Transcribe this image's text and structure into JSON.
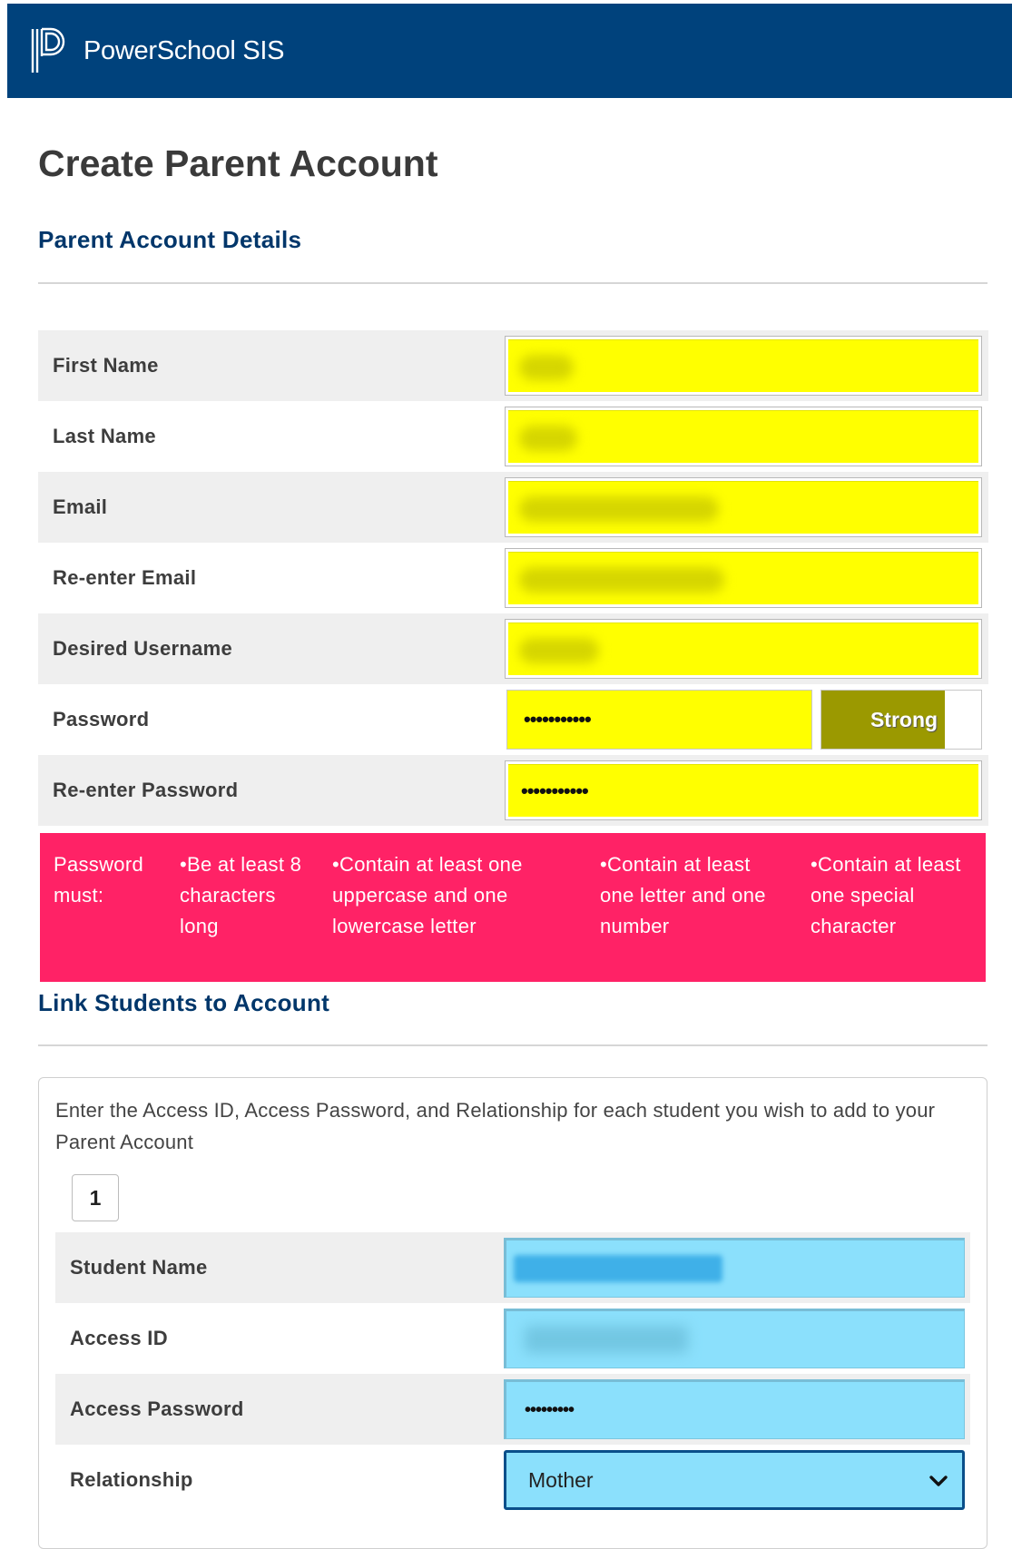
{
  "header": {
    "brand": "PowerSchool SIS",
    "logo_icon": "powerschool-p-logo-icon",
    "bg_color": "#00427c"
  },
  "page": {
    "title": "Create Parent Account"
  },
  "parent_details": {
    "heading": "Parent Account Details",
    "fields": {
      "first_name": {
        "label": "First Name"
      },
      "last_name": {
        "label": "Last Name"
      },
      "email": {
        "label": "Email"
      },
      "reenter_email": {
        "label": "Re-enter Email"
      },
      "username": {
        "label": "Desired Username"
      },
      "password": {
        "label": "Password",
        "value": "•••••••••••"
      },
      "reenter_password": {
        "label": "Re-enter Password",
        "value": "•••••••••••"
      }
    },
    "field_highlight_color": "#ffff00",
    "password_strength": {
      "label": "Strong",
      "level": 0.77,
      "color": "#9b9900"
    }
  },
  "password_rules": {
    "color": "#ff2266",
    "items": [
      "Password must:",
      "•Be at least 8 characters long",
      "•Contain at least one uppercase and one lowercase letter",
      "•Contain at least one letter and one number",
      "•Contain at least one special character"
    ]
  },
  "link_students": {
    "heading": "Link Students to Account",
    "instructions": "Enter the Access ID, Access Password, and Relationship for each student you wish to add to your Parent Account",
    "student_number": "1",
    "field_highlight_color": "#8be0fc",
    "fields": {
      "student_name": {
        "label": "Student Name"
      },
      "access_id": {
        "label": "Access ID"
      },
      "access_password": {
        "label": "Access Password",
        "value": "•••••••••"
      },
      "relationship": {
        "label": "Relationship",
        "value": "Mother"
      }
    }
  }
}
